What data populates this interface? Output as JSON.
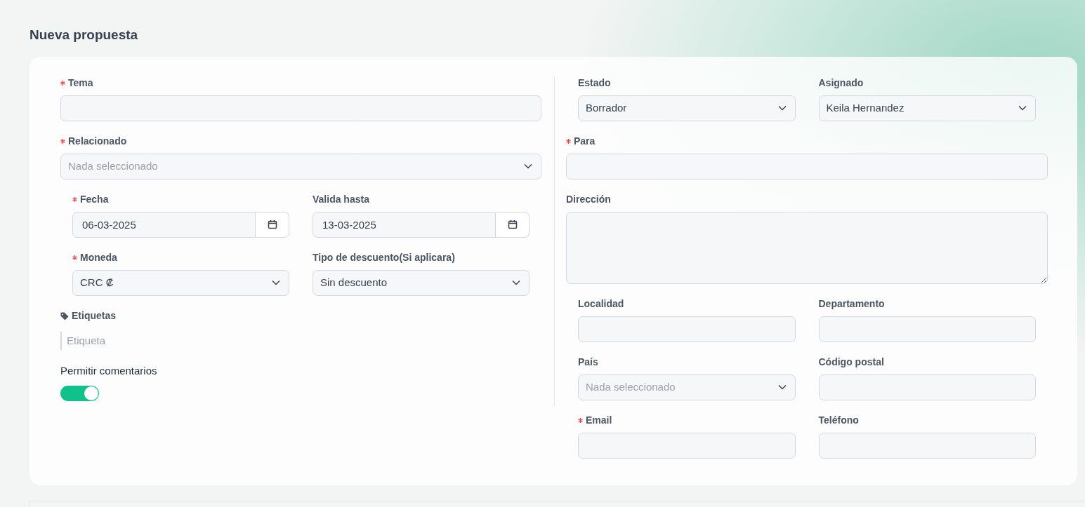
{
  "title": "Nueva propuesta",
  "left_column": [
    {
      "kind": "field",
      "field": {
        "label": "Tema",
        "required": true,
        "kind": "text"
      }
    },
    {
      "kind": "field",
      "field": {
        "label": "Relacionado",
        "required": true,
        "kind": "select",
        "placeholder": "Nada seleccionado"
      }
    },
    {
      "kind": "pair",
      "fields": [
        {
          "label": "Fecha",
          "required": true,
          "kind": "date",
          "value": "06-03-2025"
        },
        {
          "label": "Valida hasta",
          "required": false,
          "kind": "date",
          "value": "13-03-2025"
        }
      ]
    },
    {
      "kind": "pair",
      "fields": [
        {
          "label": "Moneda",
          "required": true,
          "kind": "select",
          "value": "CRC ₡"
        },
        {
          "label": "Tipo de descuento(Si aplicara)",
          "required": false,
          "kind": "select",
          "value": "Sin descuento"
        }
      ]
    },
    {
      "kind": "tags",
      "label": "Etiquetas",
      "placeholder": "Etiqueta"
    },
    {
      "kind": "toggle",
      "label": "Permitir comentarios",
      "on": true
    }
  ],
  "right_column": [
    {
      "kind": "pair",
      "fields": [
        {
          "label": "Estado",
          "required": false,
          "kind": "select",
          "value": "Borrador"
        },
        {
          "label": "Asignado",
          "required": false,
          "kind": "select",
          "value": "Keila Hernandez"
        }
      ]
    },
    {
      "kind": "field",
      "field": {
        "label": "Para",
        "required": true,
        "kind": "text"
      }
    },
    {
      "kind": "field",
      "field": {
        "label": "Dirección",
        "required": false,
        "kind": "textarea"
      }
    },
    {
      "kind": "pair",
      "fields": [
        {
          "label": "Localidad",
          "required": false,
          "kind": "text"
        },
        {
          "label": "Departamento",
          "required": false,
          "kind": "text"
        }
      ]
    },
    {
      "kind": "pair",
      "fields": [
        {
          "label": "País",
          "required": false,
          "kind": "select",
          "placeholder": "Nada seleccionado"
        },
        {
          "label": "Código postal",
          "required": false,
          "kind": "text"
        }
      ]
    },
    {
      "kind": "pair",
      "fields": [
        {
          "label": "Email",
          "required": true,
          "kind": "text"
        },
        {
          "label": "Teléfono",
          "required": false,
          "kind": "text"
        }
      ]
    }
  ]
}
